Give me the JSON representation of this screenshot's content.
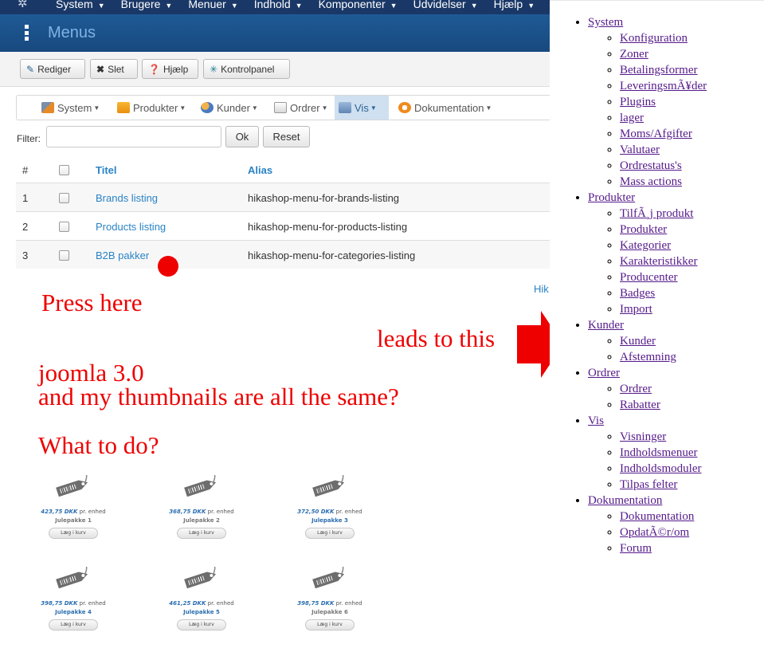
{
  "topnav": {
    "items": [
      "System",
      "Brugere",
      "Menuer",
      "Indhold",
      "Komponenter",
      "Udvidelser",
      "Hjælp"
    ]
  },
  "header": {
    "title": "Menus"
  },
  "toolbar": {
    "edit": "Rediger",
    "delete": "Slet",
    "help": "Hjælp",
    "control_panel": "Kontrolpanel"
  },
  "hikamenu": {
    "items": [
      "System",
      "Produkter",
      "Kunder",
      "Ordrer",
      "Vis",
      "Dokumentation"
    ],
    "active": "Vis"
  },
  "filter": {
    "label": "Filter:",
    "value": "",
    "ok": "Ok",
    "reset": "Reset"
  },
  "table": {
    "headers": {
      "num": "#",
      "title": "Titel",
      "alias": "Alias"
    },
    "rows": [
      {
        "num": "1",
        "title": "Brands listing",
        "alias": "hikashop-menu-for-brands-listing"
      },
      {
        "num": "2",
        "title": "Products listing",
        "alias": "hikashop-menu-for-products-listing"
      },
      {
        "num": "3",
        "title": "B2B pakker",
        "alias": "hikashop-menu-for-categories-listing"
      }
    ]
  },
  "footer_link": "Hik",
  "annotations": {
    "press_here": "Press here",
    "leads_to": "leads to this",
    "joomla": "joomla 3.0",
    "thumbs": "and my thumbnails are all the same?",
    "what_to_do": "What to do?"
  },
  "products": [
    {
      "price": "423,75 DKK",
      "unit": "pr. enhed",
      "name": "Julepakke 1",
      "cart": "Læg i kurv",
      "name_color": "#777777"
    },
    {
      "price": "368,75 DKK",
      "unit": "pr. enhed",
      "name": "Julepakke 2",
      "cart": "Læg i kurv",
      "name_color": "#777777"
    },
    {
      "price": "372,50 DKK",
      "unit": "pr. enhed",
      "name": "Julepakke 3",
      "cart": "Læg i kurv",
      "name_color": "#2a6eb0"
    },
    {
      "price": "398,75 DKK",
      "unit": "pr. enhed",
      "name": "Julepakke 4",
      "cart": "Læg i kurv",
      "name_color": "#2a6eb0"
    },
    {
      "price": "461,25 DKK",
      "unit": "pr. enhed",
      "name": "Julepakke 5",
      "cart": "Læg i kurv",
      "name_color": "#2a6eb0"
    },
    {
      "price": "398,75 DKK",
      "unit": "pr. enhed",
      "name": "Julepakke 6",
      "cart": "Læg i kurv",
      "name_color": "#777777"
    }
  ],
  "menu_list": [
    {
      "label": "System",
      "children": [
        "Konfiguration",
        "Zoner",
        "Betalingsformer",
        "LeveringsmÃ¥der",
        "Plugins",
        "lager",
        "Moms/Afgifter",
        "Valutaer",
        "Ordrestatus's",
        "Mass actions"
      ]
    },
    {
      "label": "Produkter",
      "children": [
        "TilfÃ¸j produkt",
        "Produkter",
        "Kategorier",
        "Karakteristikker",
        "Producenter",
        "Badges",
        "Import"
      ]
    },
    {
      "label": "Kunder",
      "children": [
        "Kunder",
        "Afstemning"
      ]
    },
    {
      "label": "Ordrer",
      "children": [
        "Ordrer",
        "Rabatter"
      ]
    },
    {
      "label": "Vis",
      "children": [
        "Visninger",
        "Indholdsmenuer",
        "Indholdsmoduler",
        "Tilpas felter"
      ]
    },
    {
      "label": "Dokumentation",
      "children": [
        "Dokumentation",
        "OpdatÃ©r/om",
        "Forum"
      ]
    }
  ],
  "colors": {
    "topnav": "#1a3867",
    "header": "#1f5a96",
    "link": "#2a83c6",
    "annotation_red": "#ee0000",
    "visited_link": "#551a8b"
  }
}
